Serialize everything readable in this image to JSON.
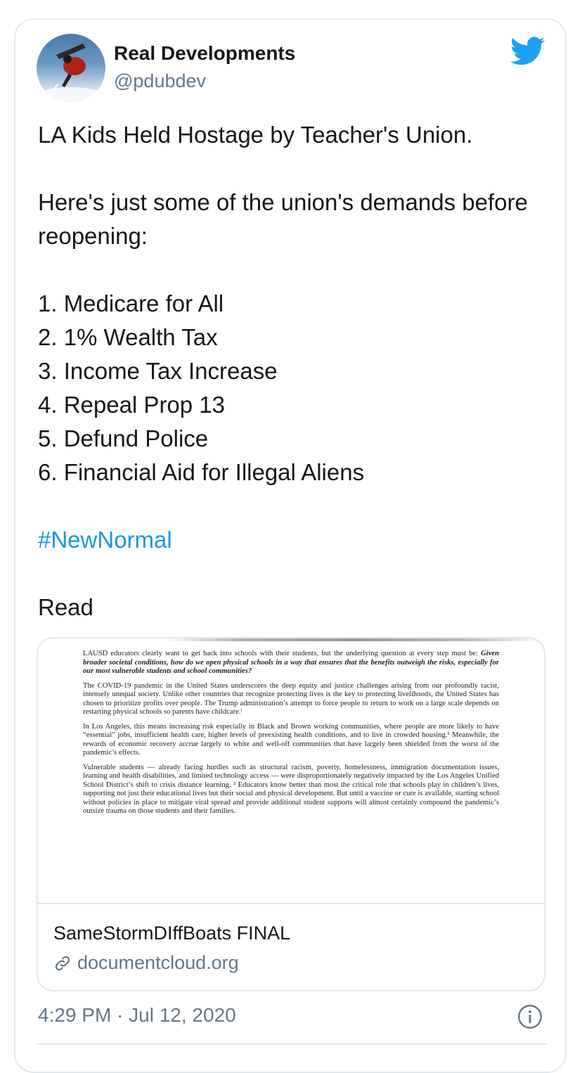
{
  "author": {
    "name": "Real Developments",
    "handle": "@pdubdev"
  },
  "tweet": {
    "line1": "LA Kids Held Hostage by Teacher's Union.",
    "line2": "Here's just some of the union's demands before reopening:",
    "demands": [
      "1. Medicare for All",
      "2. 1% Wealth Tax",
      "3. Income Tax Increase",
      "4. Repeal Prop 13",
      "5. Defund Police",
      "6. Financial Aid for Illegal Aliens"
    ],
    "hashtag": "#NewNormal",
    "read": "Read"
  },
  "card": {
    "doc_paragraphs": [
      {
        "pre": "LAUSD educators clearly want to get back into schools with their students, but the underlying question at every step must be: ",
        "bold": "Given broader societal conditions, how do we open physical schools in a way that ensures that the benefits outweigh the risks, especially for our most vulnerable students and school communities?"
      },
      {
        "pre": "The COVID-19 pandemic in the United States underscores the deep equity and justice challenges arising from our profoundly racist, intensely unequal society. Unlike other countries that recognize protecting lives is the key to protecting livelihoods, the United States has chosen to prioritize profits over people. The Trump administration’s attempt to force people to return to work on a large scale depends on restarting physical schools so parents have childcare.ⁱ",
        "bold": ""
      },
      {
        "pre": "In Los Angeles, this means increasing risk especially in Black and Brown working communities, where people are more likely to have “essential” jobs, insufficient health care, higher levels of preexisting health conditions, and to live in crowded housing.¹ Meanwhile, the rewards of economic recovery accrue largely to white and well-off communities that have largely been shielded from the worst of the pandemic’s effects.",
        "bold": ""
      },
      {
        "pre": "Vulnerable students — already facing hurdles such as structural racism, poverty, homelessness, immigration documentation issues, learning and health disabilities, and limited technology access — were disproportionately negatively impacted by the Los Angeles Unified School District’s shift to crisis distance learning. ² Educators know better than most the critical role that schools play in children’s lives, supporting not just their educational lives but their social and physical development. But until a vaccine or cure is available, starting school without policies in place to mitigate viral spread and provide additional student supports will almost certainly compound the pandemic’s outsize trauma on those students and their families.",
        "bold": ""
      }
    ],
    "title": "SameStormDIffBoats FINAL",
    "domain": "documentcloud.org"
  },
  "timestamp": "4:29 PM · Jul 12, 2020",
  "icons": {
    "brand": "twitter-bird-icon",
    "link": "link-icon",
    "info": "info-icon"
  },
  "colors": {
    "accent": "#1da1f2",
    "hashtag": "#1b95e0",
    "muted": "#657786",
    "border": "#e1e8ed"
  }
}
